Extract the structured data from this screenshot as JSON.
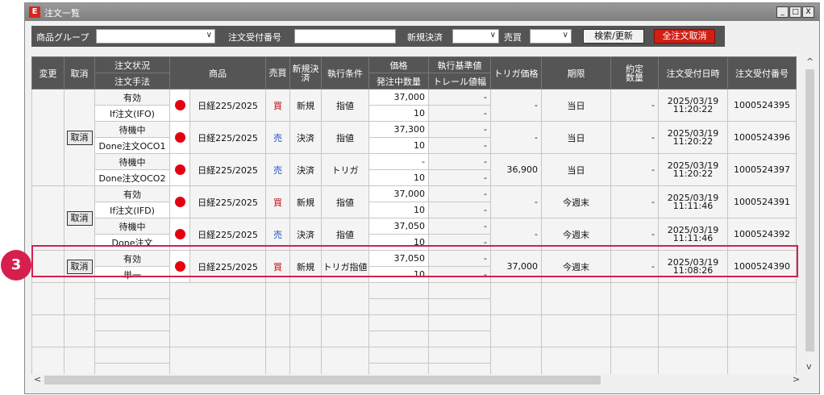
{
  "window": {
    "title": "注文一覧",
    "app_icon": "brand-e-icon",
    "controls": [
      "_",
      "□",
      "X"
    ]
  },
  "toolbar": {
    "product_group_label": "商品グループ",
    "product_group_value": "",
    "order_no_label": "注文受付番号",
    "order_no_value": "",
    "new_settle_label": "新規決済",
    "new_settle_value": "",
    "buysell_label": "売買",
    "buysell_value": "",
    "search_button": "検索/更新",
    "cancel_all_button": "全注文取消"
  },
  "headers": {
    "change": "変更",
    "cancel": "取消",
    "status": "注文状況",
    "method": "注文手法",
    "product": "商品",
    "buysell": "売買",
    "new_settle": "新規決済",
    "condition": "執行条件",
    "price": "価格",
    "qty": "発注中数量",
    "exec_base": "執行基準値",
    "trail": "トレール値幅",
    "trigger": "トリガ価格",
    "period": "期限",
    "filled": "約定数量",
    "date": "注文受付日時",
    "order_no": "注文受付番号"
  },
  "groups": [
    {
      "cancel_label": "取消",
      "method": "If注文(IFO)",
      "method2": "Done注文OCO1",
      "method3": "Done注文OCO2",
      "orders": [
        {
          "status": "有効",
          "product": "日経225/2025",
          "side": "買",
          "newsettle": "新規",
          "cond": "指値",
          "price": "37,000",
          "qty": "10",
          "base": "-",
          "trail": "-",
          "trigger": "-",
          "period": "当日",
          "filled": "-",
          "date": "2025/03/19",
          "time": "11:20:22",
          "no": "1000524395"
        },
        {
          "status": "待機中",
          "product": "日経225/2025",
          "side": "売",
          "newsettle": "決済",
          "cond": "指値",
          "price": "37,300",
          "qty": "10",
          "base": "-",
          "trail": "-",
          "trigger": "-",
          "period": "当日",
          "filled": "-",
          "date": "2025/03/19",
          "time": "11:20:22",
          "no": "1000524396"
        },
        {
          "status": "待機中",
          "product": "日経225/2025",
          "side": "売",
          "newsettle": "決済",
          "cond": "トリガ",
          "price": "-",
          "qty": "10",
          "base": "-",
          "trail": "-",
          "trigger": "36,900",
          "period": "当日",
          "filled": "-",
          "date": "2025/03/19",
          "time": "11:20:22",
          "no": "1000524397"
        }
      ]
    },
    {
      "cancel_label": "取消",
      "method": "If注文(IFD)",
      "method2": "Done注文",
      "orders": [
        {
          "status": "有効",
          "product": "日経225/2025",
          "side": "買",
          "newsettle": "新規",
          "cond": "指値",
          "price": "37,000",
          "qty": "10",
          "base": "-",
          "trail": "-",
          "trigger": "-",
          "period": "今週末",
          "filled": "-",
          "date": "2025/03/19",
          "time": "11:11:46",
          "no": "1000524391"
        },
        {
          "status": "待機中",
          "product": "日経225/2025",
          "side": "売",
          "newsettle": "決済",
          "cond": "指値",
          "price": "37,050",
          "qty": "10",
          "base": "-",
          "trail": "-",
          "trigger": "-",
          "period": "今週末",
          "filled": "-",
          "date": "2025/03/19",
          "time": "11:11:46",
          "no": "1000524392"
        }
      ]
    },
    {
      "cancel_label": "取消",
      "method": "単一",
      "orders": [
        {
          "status": "有効",
          "product": "日経225/2025",
          "side": "買",
          "newsettle": "新規",
          "cond": "トリガ指値",
          "price": "37,050",
          "qty": "10",
          "base": "-",
          "trail": "-",
          "trigger": "37,000",
          "period": "今週末",
          "filled": "-",
          "date": "2025/03/19",
          "time": "11:08:26",
          "no": "1000524390"
        }
      ]
    }
  ],
  "annotation": {
    "step": "3",
    "color": "#d61f4f"
  },
  "colors": {
    "buy": "#cc0000",
    "sell": "#1a56c8",
    "header": "#555555",
    "accent_red": "#d21f14"
  }
}
